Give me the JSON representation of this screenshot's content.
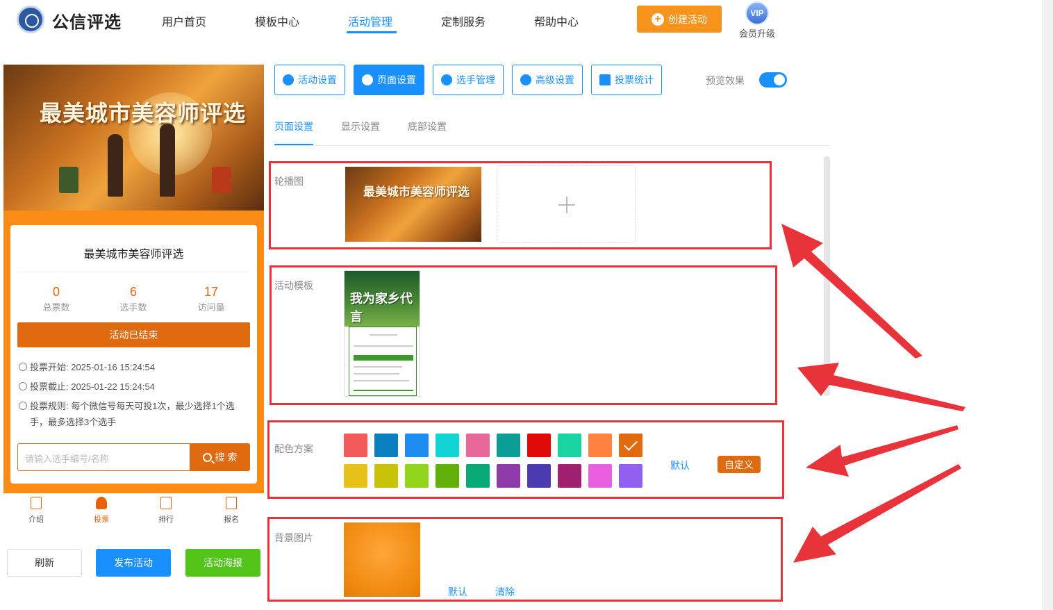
{
  "header": {
    "brand": "公信评选",
    "nav": [
      "用户首页",
      "模板中心",
      "活动管理",
      "定制服务",
      "帮助中心"
    ],
    "active_nav": "活动管理",
    "create_button": "创建活动",
    "vip_badge": "VIP",
    "vip_label": "会员升级"
  },
  "preview": {
    "banner_title": "最美城市美容师评选",
    "card_title": "最美城市美容师评选",
    "stats": [
      {
        "value": "0",
        "label": "总票数"
      },
      {
        "value": "6",
        "label": "选手数"
      },
      {
        "value": "17",
        "label": "访问量"
      }
    ],
    "status_button": "活动已结束",
    "vote_start": "投票开始:  2025-01-16 15:24:54",
    "vote_end": "投票截止:  2025-01-22 15:24:54",
    "vote_rule": "投票规则:  每个微信号每天可投1次，最少选择1个选手，最多选择3个选手",
    "search_placeholder": "请输入选手编号/名称",
    "search_button": "搜 索",
    "tabbar": [
      "介绍",
      "投票",
      "排行",
      "报名"
    ],
    "active_tab": "投票"
  },
  "actions": {
    "refresh": "刷新",
    "publish": "发布活动",
    "poster": "活动海报"
  },
  "toolbar": {
    "buttons": [
      "活动设置",
      "页面设置",
      "选手管理",
      "高级设置",
      "投票统计"
    ],
    "active": "页面设置",
    "preview_label": "预览效果",
    "preview_on": true
  },
  "subtabs": [
    "页面设置",
    "显示设置",
    "底部设置"
  ],
  "active_subtab": "页面设置",
  "sections": {
    "carousel_label": "轮播图",
    "carousel_thumb_text": "最美城市美容师评选",
    "template_label": "活动模板",
    "template_thumb_title": "我为家乡代言",
    "color_label": "配色方案",
    "color_default": "默认",
    "color_custom": "自定义",
    "bg_label": "背景图片",
    "bg_default": "默认",
    "bg_clear": "清除"
  },
  "colors": {
    "accent": "#1890ff",
    "brand_orange": "#e06a0f",
    "highlight_red": "#e8333a",
    "palette_row1": [
      "#f25a5a",
      "#0a7fc0",
      "#1e8cf0",
      "#11d4d4",
      "#e8689a",
      "#0a9e96",
      "#e00a0a",
      "#19d4a0",
      "#ff8040",
      "#e06a0f"
    ],
    "palette_row2": [
      "#e8c01a",
      "#c9c20a",
      "#92d41a",
      "#62b00a",
      "#0aaa78",
      "#8e3aa8",
      "#4c3ab0",
      "#a02070",
      "#e860e0",
      "#9160f0"
    ],
    "selected_swatch": 9
  }
}
